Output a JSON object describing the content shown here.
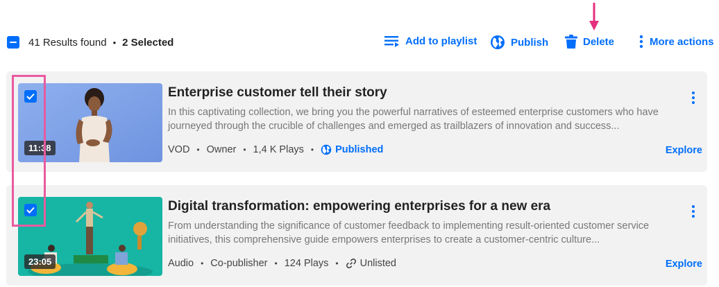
{
  "toolbar": {
    "results_label": "41 Results found",
    "separator": "•",
    "selected_label": "2 Selected",
    "actions": {
      "add_to_playlist": "Add to playlist",
      "publish": "Publish",
      "delete": "Delete",
      "more_actions": "More actions"
    }
  },
  "entries": [
    {
      "title": "Enterprise customer tell their story",
      "description": "In this captivating collection, we bring you the powerful narratives of esteemed enterprise customers who have journeyed through the crucible of challenges and emerged as trailblazers of innovation and success...",
      "duration": "11:38",
      "type": "VOD",
      "role": "Owner",
      "plays": "1,4 K Plays",
      "status": "Published",
      "status_icon": "globe-icon",
      "explore_label": "Explore",
      "selected": true
    },
    {
      "title": "Digital transformation: empowering enterprises for a new era",
      "description": "From understanding the significance of customer feedback to implementing result-oriented customer service initiatives, this comprehensive guide empowers enterprises to create a customer-centric culture...",
      "duration": "23:05",
      "type": "Audio",
      "role": "Co-publisher",
      "plays": "124 Plays",
      "status": "Unlisted",
      "status_icon": "link-icon",
      "explore_label": "Explore",
      "selected": true
    }
  ],
  "colors": {
    "accent": "#006EFA",
    "annotation": "#E5307F",
    "card_background": "#F2F2F2"
  }
}
